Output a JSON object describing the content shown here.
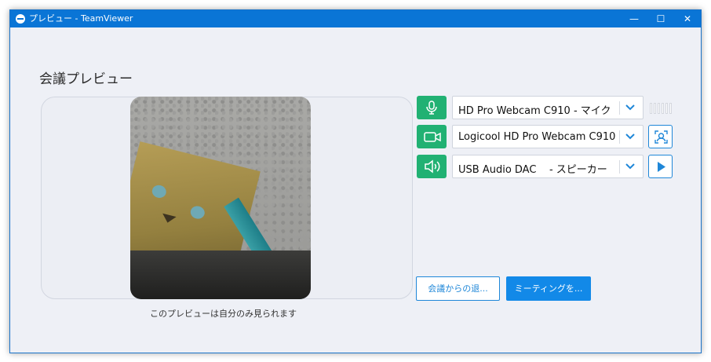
{
  "window": {
    "title": "プレビュー - TeamViewer",
    "minimize": "—",
    "maximize": "☐",
    "close": "✕"
  },
  "heading": "会議プレビュー",
  "caption": "このプレビューは自分のみ見られます",
  "devices": {
    "microphone": {
      "icon": "microphone-icon",
      "selected": "HD Pro Webcam C910 - マイク"
    },
    "camera": {
      "icon": "video-camera-icon",
      "selected": "Logicool HD Pro Webcam C910"
    },
    "speaker": {
      "icon": "speaker-icon",
      "selected": "USB Audio DAC    - スピーカー"
    }
  },
  "side_buttons": {
    "camera_adjust_icon": "face-frame-icon",
    "speaker_test_icon": "play-icon"
  },
  "buttons": {
    "leave": "会議からの退...",
    "join": "ミーティングを..."
  },
  "colors": {
    "titlebar": "#0a75d6",
    "device_icon_bg": "#21b173",
    "accent": "#1289e8"
  }
}
